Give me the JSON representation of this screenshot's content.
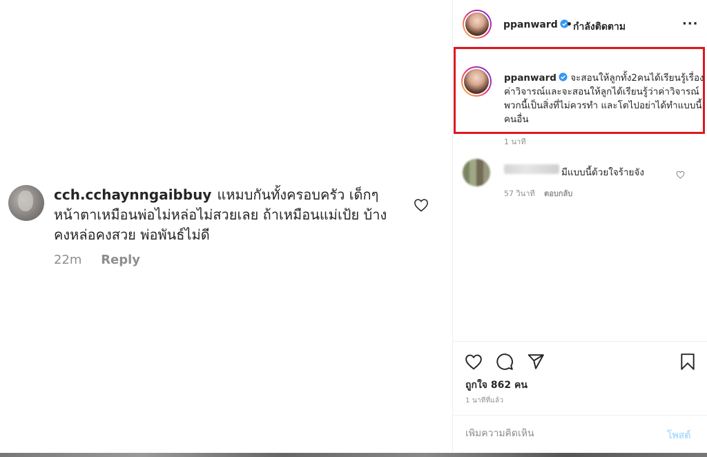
{
  "enlarged_comment": {
    "username": "cch.cchaynngaibbuy",
    "text": "แหมบกันทั้งครอบครัว เด็กๆ หน้าตาเหมือนพ่อไม่หล่อไม่สวยเลย ถ้าเหมือนแม่เป้ย บ้างคงหล่อคงสวย พ่อพันธ์ไม่ดี",
    "time": "22m",
    "reply_label": "Reply",
    "icons": {
      "like": "heart-outline-icon"
    }
  },
  "post": {
    "header": {
      "username": "ppanward",
      "separator": "•",
      "follow_status": "กำลังติดตาม",
      "more": "···",
      "icons": {
        "verified": "verified-badge-icon",
        "options": "more-options-icon"
      }
    },
    "caption": {
      "username": "ppanward",
      "text": "จะสอนให้ลูกทั้ง2คนได้เรียนรู้เรื่องค่าวิจารณ์และจะสอนให้ลูกได้เรียนรู้ว่าค่าวิจารณ์พวกนี้เป็นสิ่งที่ไม่ควรทำ และโตไปอย่าได้ทำแบบนี้คนอื่น",
      "time": "1 นาที",
      "highlight_color": "#e0161d"
    },
    "comments": [
      {
        "text": "มีแบบนี้ด้วยใจร้ายจัง",
        "time": "57 วินาที",
        "reply_label": "ตอบกลับ"
      }
    ],
    "actions": {
      "icons": [
        "heart-icon",
        "comment-icon",
        "share-icon",
        "bookmark-icon"
      ],
      "likes": "ถูกใจ 862 คน",
      "posted": "1 นาทีที่แล้ว"
    },
    "add_comment": {
      "placeholder": "เพิ่มความคิดเห็น",
      "post_label": "โพสต์"
    }
  },
  "colors": {
    "accent_blue": "#3897f0",
    "post_disabled": "#b2dffc",
    "text": "#262626",
    "muted": "#8e8e8e"
  }
}
